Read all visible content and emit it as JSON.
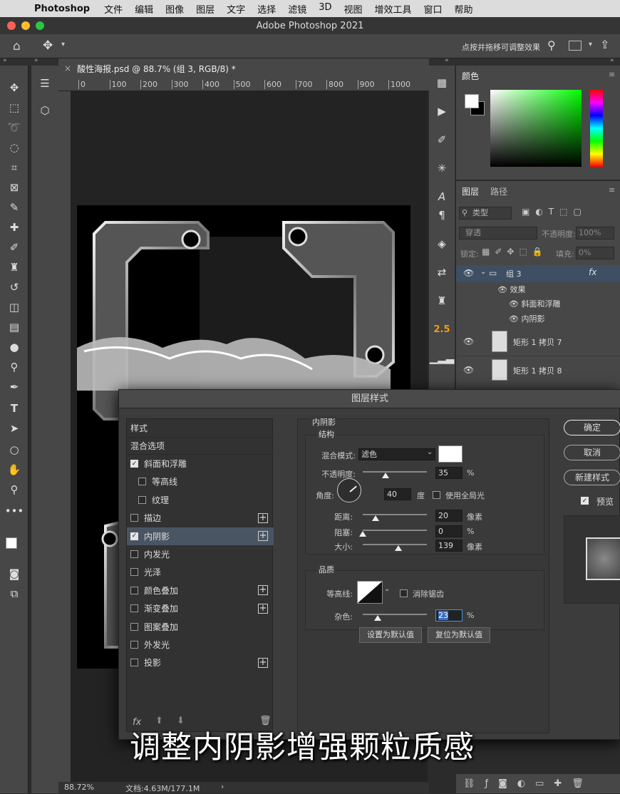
{
  "menubar": {
    "app": "Photoshop",
    "items": [
      "文件",
      "编辑",
      "图像",
      "图层",
      "文字",
      "选择",
      "滤镜",
      "3D",
      "视图",
      "增效工具",
      "窗口",
      "帮助"
    ]
  },
  "window": {
    "title": "Adobe Photoshop 2021"
  },
  "optionsbar": {
    "hint": "点按并拖移可调整效果"
  },
  "document": {
    "tab": "酸性海报.psd @ 88.7% (组 3, RGB/8) *",
    "ruler_labels": [
      "0",
      "100",
      "200",
      "300",
      "400",
      "500",
      "600",
      "700",
      "800",
      "900",
      "1000"
    ],
    "zoom": "88.72%",
    "docinfo": "文档:4.63M/177.1M"
  },
  "color_panel": {
    "title": "颜色"
  },
  "layers_panel": {
    "tabs": [
      "图层",
      "路径"
    ],
    "search_placeholder": "类型",
    "blend": "穿透",
    "opacity_label": "不透明度:",
    "opacity": "100%",
    "lock_label": "锁定:",
    "fill_label": "填充:",
    "fill": "0%",
    "layers": [
      {
        "name": "组 3",
        "fx": "fx"
      },
      {
        "name": "效果"
      },
      {
        "name": "斜面和浮雕"
      },
      {
        "name": "内阴影"
      },
      {
        "name": "矩形 1 拷贝 7"
      },
      {
        "name": "矩形 1 拷贝 8"
      }
    ]
  },
  "iconstrip": {
    "badge": "2.5"
  },
  "dialog": {
    "title": "图层样式",
    "styles_header": "样式",
    "blend_options": "混合选项",
    "styles": [
      {
        "label": "斜面和浮雕",
        "checked": true,
        "plus": false,
        "indent": false
      },
      {
        "label": "等高线",
        "checked": false,
        "plus": false,
        "indent": true
      },
      {
        "label": "纹理",
        "checked": false,
        "plus": false,
        "indent": true
      },
      {
        "label": "描边",
        "checked": false,
        "plus": true,
        "indent": false
      },
      {
        "label": "内阴影",
        "checked": true,
        "plus": true,
        "indent": false,
        "selected": true
      },
      {
        "label": "内发光",
        "checked": false,
        "plus": false,
        "indent": false
      },
      {
        "label": "光泽",
        "checked": false,
        "plus": false,
        "indent": false
      },
      {
        "label": "颜色叠加",
        "checked": false,
        "plus": true,
        "indent": false
      },
      {
        "label": "渐变叠加",
        "checked": false,
        "plus": true,
        "indent": false
      },
      {
        "label": "图案叠加",
        "checked": false,
        "plus": false,
        "indent": false
      },
      {
        "label": "外发光",
        "checked": false,
        "plus": false,
        "indent": false
      },
      {
        "label": "投影",
        "checked": false,
        "plus": true,
        "indent": false
      }
    ],
    "fx_label": "fx",
    "section_title": "内阴影",
    "structure_title": "结构",
    "blend_mode_label": "混合模式:",
    "blend_mode": "滤色",
    "opacity_label": "不透明度:",
    "opacity": "35",
    "opacity_level": 0.35,
    "angle_label": "角度:",
    "angle": "40",
    "angle_unit": "度",
    "global_light": "使用全局光",
    "distance_label": "距离:",
    "distance": "20",
    "distance_level": 0.2,
    "choke_label": "阻塞:",
    "choke": "0",
    "choke_level": 0.0,
    "size_label": "大小:",
    "size": "139",
    "size_level": 0.556,
    "unit_px": "像素",
    "unit_pct": "%",
    "quality_title": "品质",
    "contour_label": "等高线:",
    "antialias": "消除锯齿",
    "noise_label": "杂色:",
    "noise": "23",
    "noise_level": 0.23,
    "set_default": "设置为默认值",
    "reset_default": "复位为默认值",
    "ok": "确定",
    "cancel": "取消",
    "new_style": "新建样式",
    "preview": "预览"
  },
  "subtitle": "调整内阴影增强颗粒质感"
}
